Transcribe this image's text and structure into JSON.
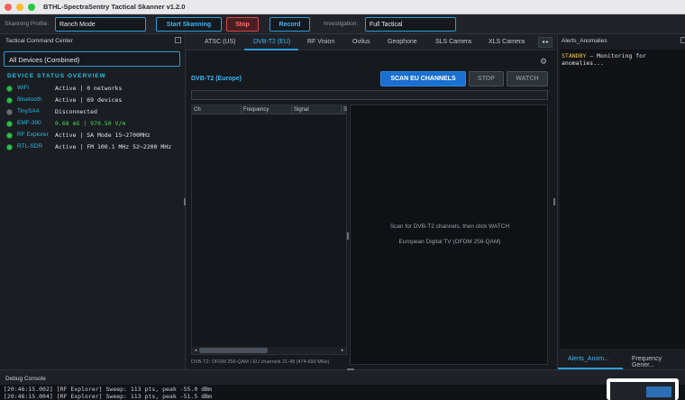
{
  "app": {
    "title": "BTHL-SpectraSentry Tactical Skanner v1.2.0"
  },
  "toolbar": {
    "profile_label": "Skanning Profile:",
    "profile_value": "Ranch Mode",
    "start_label": "Start Skanning",
    "stop_label": "Stop",
    "record_label": "Record",
    "investigation_label": "Investigation:",
    "investigation_value": "Full Tactical"
  },
  "left_panel": {
    "title": "Tactical Command Center",
    "device_select": "All Devices (Combined)",
    "overview_title": "DEVICE STATUS OVERVIEW",
    "devices": [
      {
        "name": "WiFi",
        "status": "Active | 0 networks",
        "state": "active"
      },
      {
        "name": "Bluetooth",
        "status": "Active | 69 devices",
        "state": "active"
      },
      {
        "name": "TinySA4",
        "status": "Disconnected",
        "state": "disconnected"
      },
      {
        "name": "EMF-390",
        "status": "0.68 mG | 970.50 V/m",
        "state": "active"
      },
      {
        "name": "RF Explorer",
        "status": "Active | SA Mode  15~2700MHz",
        "state": "active"
      },
      {
        "name": "RTL-SDR",
        "status": "Active | FM 100.1 MHz  52~2200 MHz",
        "state": "active"
      }
    ]
  },
  "center": {
    "tabs": [
      "ATSC (US)",
      "DVB-T2 (EU)",
      "RF Vision",
      "Ovilus",
      "Geophone",
      "SLS Camera",
      "XLS Camera"
    ],
    "active_tab": "DVB-T2 (EU)",
    "title": "DVB-T2 (Europe)",
    "scan_label": "SCAN EU CHANNELS",
    "stop_label": "STOP",
    "watch_label": "WATCH",
    "columns": [
      "Ch",
      "Frequency",
      "Signal",
      "S"
    ],
    "footer": "DVB-T2: OFDM 256-QAM | EU channels 21-48 (474-690 MHz)",
    "viewer_line1": "Scan for DVB-T2 channels, then click WATCH",
    "viewer_line2": "European Digital TV (OFDM 256-QAM)"
  },
  "right_panel": {
    "title": "Alerts_Anomalies",
    "standby": "STANDBY",
    "message": " — Monitoring for anomalies...",
    "tabs": [
      "Alerts_Anom...",
      "Frequency Gener..."
    ]
  },
  "debug": {
    "title": "Debug Console",
    "lines": [
      "[20:46:15.002] [RF Explorer] Sweep: 113 pts, peak -55.0 dBm",
      "[20:46:15.004] [RF Explorer] Sweep: 113 pts, peak -51.5 dBm"
    ]
  },
  "colors": {
    "accent": "#2c9bd6",
    "active_green": "#2fbf4f",
    "stop_red": "#d8464a",
    "scan_blue": "#1a6fd0",
    "standby_yellow": "#f0c64a"
  }
}
